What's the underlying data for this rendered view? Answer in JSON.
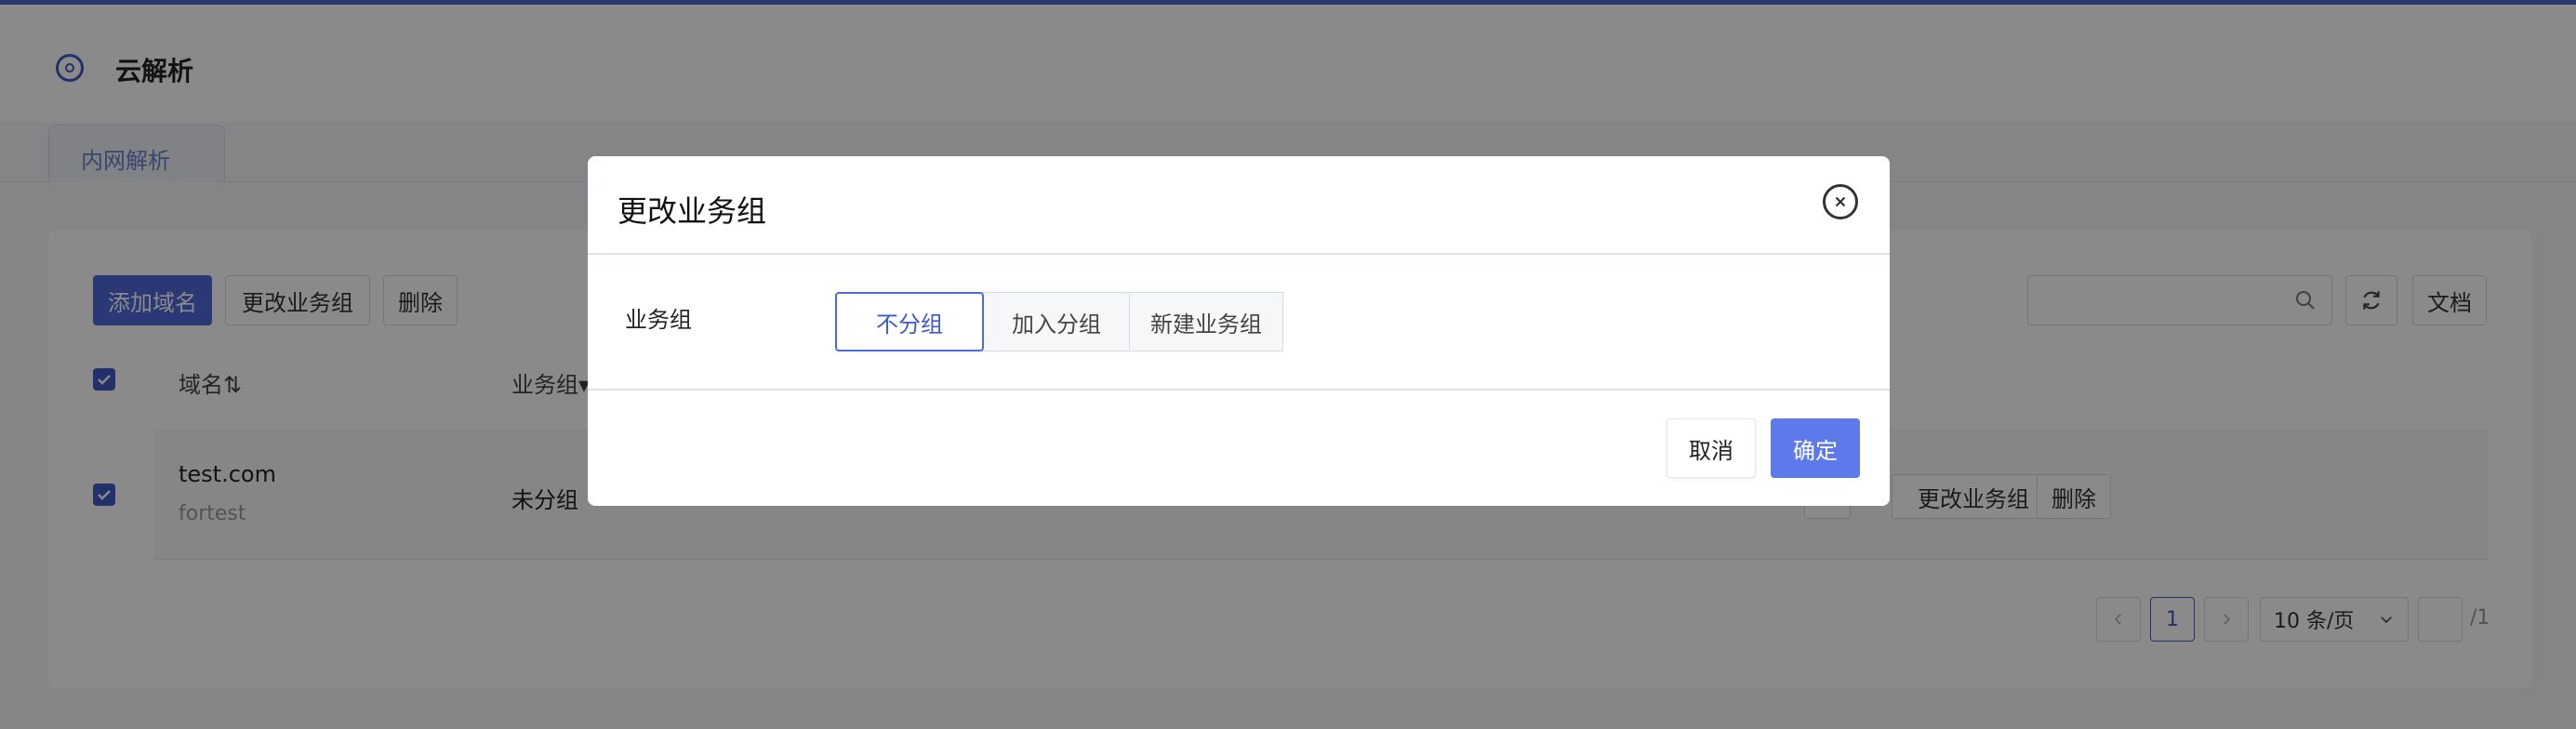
{
  "app": {
    "title": "云解析"
  },
  "tabs": [
    {
      "label": "内网解析"
    }
  ],
  "toolbar": {
    "add_domain": "添加域名",
    "change_group": "更改业务组",
    "delete": "删除",
    "docs": "文档",
    "search_placeholder": ""
  },
  "table": {
    "headers": [
      "域名⇅",
      "业务组▾"
    ],
    "rows": [
      {
        "domain": "test.com",
        "remark": "fortest",
        "group": "未分组",
        "actions": [
          "更改业务组",
          "删除"
        ]
      }
    ]
  },
  "pagination": {
    "current_page": "1",
    "page_size": "10 条/页",
    "total_pages": "/1"
  },
  "modal": {
    "title": "更改业务组",
    "field_label": "业务组",
    "options": [
      "不分组",
      "加入分组",
      "新建业务组"
    ],
    "selected": "不分组",
    "cancel": "取消",
    "confirm": "确定"
  },
  "colors": {
    "primary": "#4f68d8",
    "brand": "#3f5bc6",
    "overlay": "rgba(0,0,0,0.46)"
  }
}
